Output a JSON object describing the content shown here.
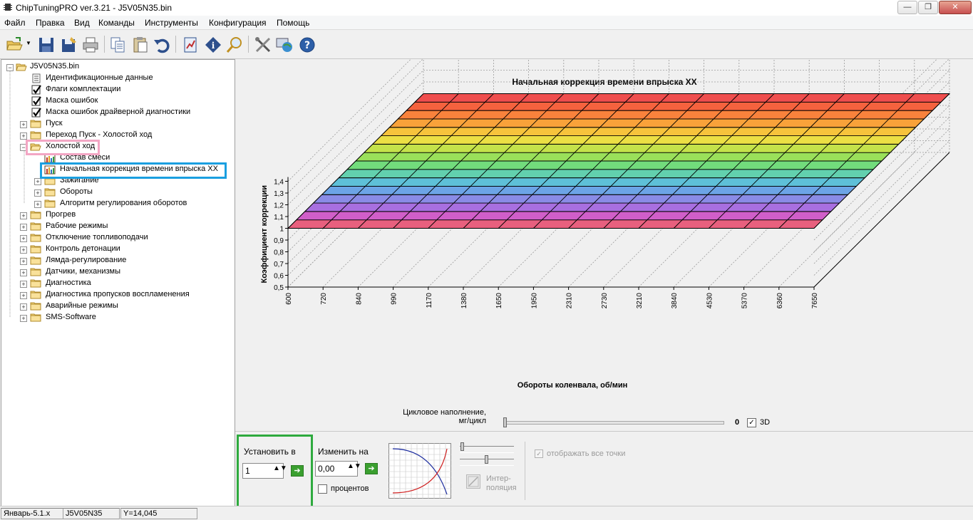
{
  "window": {
    "title": "ChipTuningPRO ver.3.21 - J5V05N35.bin",
    "min_glyph": "—",
    "max_glyph": "❐",
    "close_glyph": "✕"
  },
  "menu": [
    "Файл",
    "Правка",
    "Вид",
    "Команды",
    "Инструменты",
    "Конфигурация",
    "Помощь"
  ],
  "toolbar": {
    "icons": [
      "open-folder-icon",
      "save-icon",
      "save-as-icon",
      "print-icon",
      "copy-icon",
      "paste-icon",
      "undo-icon",
      "table-report-icon",
      "info-icon",
      "search-icon",
      "tools-icon",
      "globe-icon",
      "help-icon"
    ]
  },
  "tree": {
    "root": "J5V05N35.bin",
    "items": [
      {
        "label": "Идентификационные данные",
        "icon": "document",
        "level": 1,
        "expander": ""
      },
      {
        "label": "Флаги комплектации",
        "icon": "checkbox",
        "level": 1,
        "expander": ""
      },
      {
        "label": "Маска ошибок",
        "icon": "checkbox",
        "level": 1,
        "expander": ""
      },
      {
        "label": "Маска ошибок драйверной диагностики",
        "icon": "checkbox",
        "level": 1,
        "expander": ""
      },
      {
        "label": "Пуск",
        "icon": "folder",
        "level": 1,
        "expander": "+"
      },
      {
        "label": "Переход Пуск - Холостой ход",
        "icon": "folder",
        "level": 1,
        "expander": "+"
      },
      {
        "label": "Холостой ход",
        "icon": "folder-open",
        "level": 1,
        "expander": "-"
      },
      {
        "label": "Состав смеси",
        "icon": "chart",
        "level": 2,
        "expander": ""
      },
      {
        "label": "Начальная коррекция времени впрыска ХХ",
        "icon": "chart",
        "level": 2,
        "expander": ""
      },
      {
        "label": "Зажигание",
        "icon": "folder",
        "level": 2,
        "expander": "+"
      },
      {
        "label": "Обороты",
        "icon": "folder",
        "level": 2,
        "expander": "+"
      },
      {
        "label": "Алгоритм регулирования оборотов",
        "icon": "folder",
        "level": 2,
        "expander": "+"
      },
      {
        "label": "Прогрев",
        "icon": "folder",
        "level": 1,
        "expander": "+"
      },
      {
        "label": "Рабочие режимы",
        "icon": "folder",
        "level": 1,
        "expander": "+"
      },
      {
        "label": "Отключение топливоподачи",
        "icon": "folder",
        "level": 1,
        "expander": "+"
      },
      {
        "label": "Контроль детонации",
        "icon": "folder",
        "level": 1,
        "expander": "+"
      },
      {
        "label": "Лямда-регулирование",
        "icon": "folder",
        "level": 1,
        "expander": "+"
      },
      {
        "label": "Датчики, механизмы",
        "icon": "folder",
        "level": 1,
        "expander": "+"
      },
      {
        "label": "Диагностика",
        "icon": "folder",
        "level": 1,
        "expander": "+"
      },
      {
        "label": "Диагностика пропусков воспламенения",
        "icon": "folder",
        "level": 1,
        "expander": "+"
      },
      {
        "label": "Аварийные режимы",
        "icon": "folder",
        "level": 1,
        "expander": "+"
      },
      {
        "label": "SMS-Software",
        "icon": "folder",
        "level": 1,
        "expander": "+"
      }
    ]
  },
  "chart_data": {
    "type": "surface-3d",
    "title": "Начальная коррекция времени впрыска ХХ",
    "xlabel": "Обороты коленвала, об/мин",
    "ylabel": "Коэффициент коррекции",
    "x": [
      "600",
      "720",
      "840",
      "990",
      "1170",
      "1380",
      "1650",
      "1950",
      "2310",
      "2730",
      "3210",
      "3840",
      "4530",
      "5370",
      "6360",
      "7650"
    ],
    "yticks": [
      "0,5",
      "0,6",
      "0,7",
      "0,8",
      "0,9",
      "1",
      "1,1",
      "1,2",
      "1,3",
      "1,4"
    ],
    "ylim": [
      0.5,
      1.4
    ],
    "surface_value": 1,
    "z_rows": 16,
    "grid": true,
    "colormap": [
      "#e8607e",
      "#d05ec9",
      "#a86fe0",
      "#8a8be6",
      "#6ca4e6",
      "#5ec0d8",
      "#62d0ae",
      "#72dc7c",
      "#9ae05a",
      "#c4e24a",
      "#ecdf44",
      "#f7c33c",
      "#f9a23a",
      "#f9823c",
      "#f5623e",
      "#ef4e4e"
    ]
  },
  "controls": {
    "slider_label_1": "Цикловое наполнение,",
    "slider_label_2": "мг/цикл",
    "slider_value": "0",
    "checkbox_3d_label": "3D",
    "checkbox_3d_checked": true,
    "set_label": "Установить в",
    "set_value": "1",
    "change_label": "Изменить на",
    "change_value": "0,00",
    "percent_label": "процентов",
    "interp_label_1": "Интер-",
    "interp_label_2": "поляция",
    "show_all_points_label": "отображать все точки"
  },
  "status": {
    "profile": "Январь-5.1.x",
    "file": "J5V05N35",
    "y_value": "Y=14,045"
  },
  "accents": {
    "highlight_pink": "#f3a6c4",
    "highlight_blue": "#1a9fe0",
    "highlight_green": "#2eaa3e"
  }
}
